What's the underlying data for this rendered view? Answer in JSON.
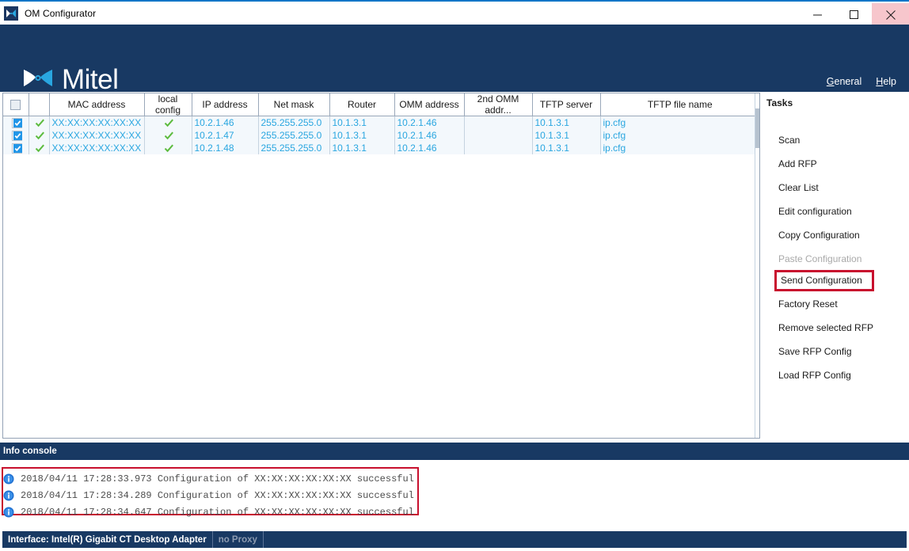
{
  "window": {
    "title": "OM Configurator",
    "app_icon": "mitel-app-icon",
    "controls": {
      "minimize": "minimize-icon",
      "maximize": "maximize-icon",
      "close": "close-icon"
    }
  },
  "brand": {
    "logo_text": "Mitel",
    "logo_mark": "mitel-bowtie-logo",
    "links": [
      {
        "name": "general",
        "mnemonic": "G",
        "rest": "eneral"
      },
      {
        "name": "help",
        "mnemonic": "H",
        "rest": "elp"
      }
    ]
  },
  "table": {
    "columns": [
      {
        "key": "select",
        "label": ""
      },
      {
        "key": "status",
        "label": ""
      },
      {
        "key": "mac",
        "label": "MAC address"
      },
      {
        "key": "local_config",
        "label": "local config"
      },
      {
        "key": "ip",
        "label": "IP address"
      },
      {
        "key": "netmask",
        "label": "Net mask"
      },
      {
        "key": "router",
        "label": "Router"
      },
      {
        "key": "omm",
        "label": "OMM address"
      },
      {
        "key": "omm2",
        "label": "2nd OMM addr..."
      },
      {
        "key": "tftp_server",
        "label": "TFTP server"
      },
      {
        "key": "tftp_file",
        "label": "TFTP file name"
      }
    ],
    "header_checkbox_checked": false,
    "rows": [
      {
        "selected": true,
        "status_ok": true,
        "mac": "XX:XX:XX:XX:XX:XX",
        "local_config_ok": true,
        "ip": "10.2.1.46",
        "netmask": "255.255.255.0",
        "router": "10.1.3.1",
        "omm": "10.2.1.46",
        "omm2": "",
        "tftp_server": "10.1.3.1",
        "tftp_file": "ip.cfg"
      },
      {
        "selected": true,
        "status_ok": true,
        "mac": "XX:XX:XX:XX:XX:XX",
        "local_config_ok": true,
        "ip": "10.2.1.47",
        "netmask": "255.255.255.0",
        "router": "10.1.3.1",
        "omm": "10.2.1.46",
        "omm2": "",
        "tftp_server": "10.1.3.1",
        "tftp_file": "ip.cfg"
      },
      {
        "selected": true,
        "status_ok": true,
        "mac": "XX:XX:XX:XX:XX:XX",
        "local_config_ok": true,
        "ip": "10.2.1.48",
        "netmask": "255.255.255.0",
        "router": "10.1.3.1",
        "omm": "10.2.1.46",
        "omm2": "",
        "tftp_server": "10.1.3.1",
        "tftp_file": "ip.cfg"
      }
    ]
  },
  "tasks": {
    "title": "Tasks",
    "items": [
      {
        "label": "Scan",
        "state": "enabled"
      },
      {
        "label": "Add RFP",
        "state": "enabled"
      },
      {
        "label": "Clear List",
        "state": "enabled"
      },
      {
        "label": "Edit configuration",
        "state": "enabled"
      },
      {
        "label": "Copy Configuration",
        "state": "enabled"
      },
      {
        "label": "Paste Configuration",
        "state": "disabled"
      },
      {
        "label": "Send Configuration",
        "state": "highlighted"
      },
      {
        "label": "Factory Reset",
        "state": "enabled"
      },
      {
        "label": "Remove selected RFP",
        "state": "enabled"
      },
      {
        "label": "Save RFP Config",
        "state": "enabled"
      },
      {
        "label": "Load RFP Config",
        "state": "enabled"
      }
    ]
  },
  "console": {
    "title": "Info console",
    "lines": [
      {
        "icon": "info-icon",
        "text": "2018/04/11 17:28:33.973 Configuration of XX:XX:XX:XX:XX:XX successful"
      },
      {
        "icon": "info-icon",
        "text": "2018/04/11 17:28:34.289 Configuration of XX:XX:XX:XX:XX:XX successful"
      },
      {
        "icon": "info-icon",
        "text": "2018/04/11 17:28:34.647 Configuration of XX:XX:XX:XX:XX:XX successful"
      }
    ]
  },
  "statusbar": {
    "interface": "Interface: Intel(R) Gigabit CT Desktop Adapter",
    "proxy": "no Proxy"
  },
  "colors": {
    "brand_navy": "#183963",
    "accent_cyan": "#29a6e0",
    "highlight_red": "#c8102e",
    "check_green": "#5cbb3e",
    "checkbox_blue": "#2196e8",
    "close_hover": "#f7c6cc"
  }
}
